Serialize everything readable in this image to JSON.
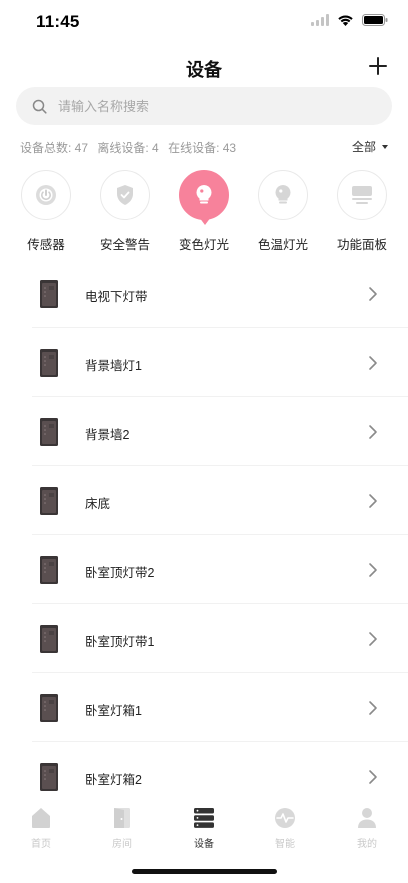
{
  "status_bar": {
    "time": "11:45"
  },
  "header": {
    "title": "设备",
    "add_icon": "plus-icon"
  },
  "search": {
    "placeholder": "请输入名称搜索",
    "value": ""
  },
  "stats": {
    "total": "设备总数: 47",
    "offline": "离线设备: 4",
    "online": "在线设备: 43",
    "filter_label": "全部"
  },
  "categories": [
    {
      "label": "传感器",
      "icon": "sensor-icon",
      "active": false
    },
    {
      "label": "安全警告",
      "icon": "shield-icon",
      "active": false
    },
    {
      "label": "变色灯光",
      "icon": "color-bulb-icon",
      "active": true
    },
    {
      "label": "色温灯光",
      "icon": "bulb-icon",
      "active": false
    },
    {
      "label": "功能面板",
      "icon": "panel-icon",
      "active": false
    }
  ],
  "devices": [
    {
      "name": "电视下灯带"
    },
    {
      "name": "背景墙灯1"
    },
    {
      "name": "背景墙2"
    },
    {
      "name": "床底"
    },
    {
      "name": "卧室顶灯带2"
    },
    {
      "name": "卧室顶灯带1"
    },
    {
      "name": "卧室灯箱1"
    },
    {
      "name": "卧室灯箱2"
    }
  ],
  "tabs": [
    {
      "label": "首页",
      "icon": "home-icon",
      "active": false
    },
    {
      "label": "房间",
      "icon": "room-icon",
      "active": false
    },
    {
      "label": "设备",
      "icon": "devices-icon",
      "active": true
    },
    {
      "label": "智能",
      "icon": "smart-icon",
      "active": false
    },
    {
      "label": "我的",
      "icon": "profile-icon",
      "active": false
    }
  ],
  "colors": {
    "accent": "#f7829b",
    "muted": "#9a9a9a",
    "tab_inactive": "#c9c9c9"
  }
}
